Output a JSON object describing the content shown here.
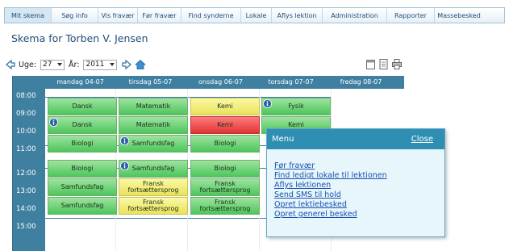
{
  "nav": {
    "tabs": [
      "Mit skema",
      "Søg info",
      "Vis fravær",
      "Før fravær",
      "Find synderne",
      "Lokale",
      "Aflys lektion",
      "Administration",
      "Rapporter",
      "Massebesked"
    ],
    "active": 0
  },
  "page_title": "Skema for Torben V. Jensen",
  "week_controls": {
    "uge_label": "Uge:",
    "uge_value": "27",
    "aar_label": "År:",
    "aar_value": "2011"
  },
  "schedule": {
    "days": [
      "mandag 04-07",
      "tirsdag 05-07",
      "onsdag 06-07",
      "torsdag 07-07",
      "fredag 08-07"
    ],
    "times": [
      "08:00",
      "09:00",
      "10:00",
      "11:00",
      "12:00",
      "13:00",
      "14:00",
      "15:00"
    ],
    "lessons": [
      {
        "text": "Dansk",
        "color": "green",
        "day": 0,
        "slot": 0,
        "info": false
      },
      {
        "text": "Matematik",
        "color": "green",
        "day": 1,
        "slot": 0,
        "info": false
      },
      {
        "text": "Kemi",
        "color": "yellow",
        "day": 2,
        "slot": 0,
        "info": false
      },
      {
        "text": "Fysik",
        "color": "green",
        "day": 3,
        "slot": 0,
        "info": true
      },
      {
        "text": "Dansk",
        "color": "green",
        "day": 0,
        "slot": 1,
        "info": true
      },
      {
        "text": "Matematik",
        "color": "green",
        "day": 1,
        "slot": 1,
        "info": false
      },
      {
        "text": "Kemi",
        "color": "red",
        "day": 2,
        "slot": 1,
        "info": false
      },
      {
        "text": "Kemi",
        "color": "green",
        "day": 3,
        "slot": 1,
        "info": false
      },
      {
        "text": "Biologi",
        "color": "green",
        "day": 0,
        "slot": 2,
        "info": false
      },
      {
        "text": "Samfundsfag",
        "color": "green",
        "day": 1,
        "slot": 2,
        "info": true
      },
      {
        "text": "Biologi",
        "color": "green",
        "day": 2,
        "slot": 2,
        "info": false
      },
      {
        "text": "Biologi",
        "color": "green",
        "day": 0,
        "slot": 3,
        "info": false
      },
      {
        "text": "Samfundsfag",
        "color": "green",
        "day": 1,
        "slot": 3,
        "info": true
      },
      {
        "text": "Biologi",
        "color": "green",
        "day": 2,
        "slot": 3,
        "info": false
      },
      {
        "text": "Samfundsfag",
        "color": "green",
        "day": 0,
        "slot": 4,
        "info": false
      },
      {
        "text": "Fransk fortsættersprog",
        "color": "yellow",
        "day": 1,
        "slot": 4,
        "info": false
      },
      {
        "text": "Fransk fortsættersprog",
        "color": "green",
        "day": 2,
        "slot": 4,
        "info": false
      },
      {
        "text": "Samfundsfag",
        "color": "green",
        "day": 0,
        "slot": 5,
        "info": false
      },
      {
        "text": "Fransk fortsættersprog",
        "color": "yellow",
        "day": 1,
        "slot": 5,
        "info": false
      },
      {
        "text": "Fransk fortsættersprog",
        "color": "green",
        "day": 2,
        "slot": 5,
        "info": false
      }
    ]
  },
  "popup": {
    "title": "Menu",
    "close": "Close",
    "links": [
      "Før fravær",
      "Find ledigt lokale til lektionen",
      "Aflys lektionen",
      "Send SMS til hold",
      "Opret lektiebesked",
      "Opret generel besked"
    ]
  },
  "colors": {
    "header_blue": "#3f7fa0",
    "popup_head": "#2f8fb2",
    "lesson_green": "#4cc65a",
    "lesson_yellow": "#e9e25a",
    "lesson_red": "#e13434"
  }
}
